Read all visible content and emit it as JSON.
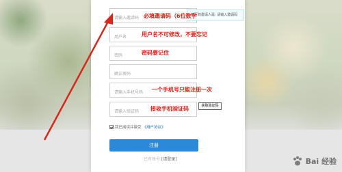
{
  "form": {
    "invite_placeholder": "请输入邀请码",
    "username_placeholder": "用户名",
    "password_placeholder": "密码",
    "confirm_placeholder": "确认密码",
    "phone_placeholder": "请输入手机号码",
    "sms_placeholder": "请输入验证码",
    "sms_button": "获取验证码",
    "tip_text": "填写的邀请人是: 请输入邀请码",
    "agree_text": "我已阅读并接受",
    "agree_link": "《用户协议》",
    "register_button": "注册",
    "login_prompt": "已有账号,",
    "login_link": "[请登录]"
  },
  "annotations": {
    "invite": "必填邀请码（6位数字",
    "username": "用户名不可修改，不要忘记",
    "password": "密码要记住",
    "phone": "一个手机号只能注册一次",
    "sms": "接收手机验证码"
  },
  "watermark": {
    "text": "Bai  经验"
  },
  "colors": {
    "annotation": "#d9251b",
    "primary_button": "#2b89d8"
  }
}
